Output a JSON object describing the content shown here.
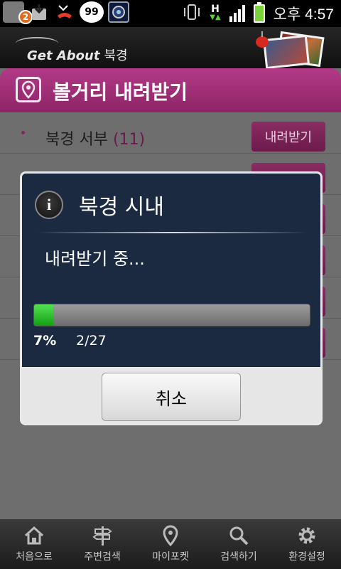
{
  "status_bar": {
    "notification_count": "2",
    "paw_count": "99",
    "network_letter": "H",
    "clock": "오후 4:57"
  },
  "app": {
    "logo_text": "Get About",
    "logo_city": "북경"
  },
  "page": {
    "title": "볼거리 내려받기",
    "rows": [
      {
        "label": "북경 서부",
        "count": "(11)",
        "button": "내려받기"
      }
    ]
  },
  "dialog": {
    "title": "북경 시내",
    "message": "내려받기 중...",
    "progress_percent": "7%",
    "progress_fraction": 0.07,
    "progress_count": "2/27",
    "cancel_label": "취소"
  },
  "bottom_nav": [
    {
      "label": "처음으로",
      "icon": "home-icon"
    },
    {
      "label": "주변검색",
      "icon": "signpost-icon"
    },
    {
      "label": "마이포켓",
      "icon": "location-pin-icon"
    },
    {
      "label": "검색하기",
      "icon": "search-icon"
    },
    {
      "label": "환경설정",
      "icon": "gear-icon"
    }
  ],
  "colors": {
    "accent": "#9c2b73",
    "progress": "#3cc43c",
    "dialog_bg": "#1b2a40"
  }
}
